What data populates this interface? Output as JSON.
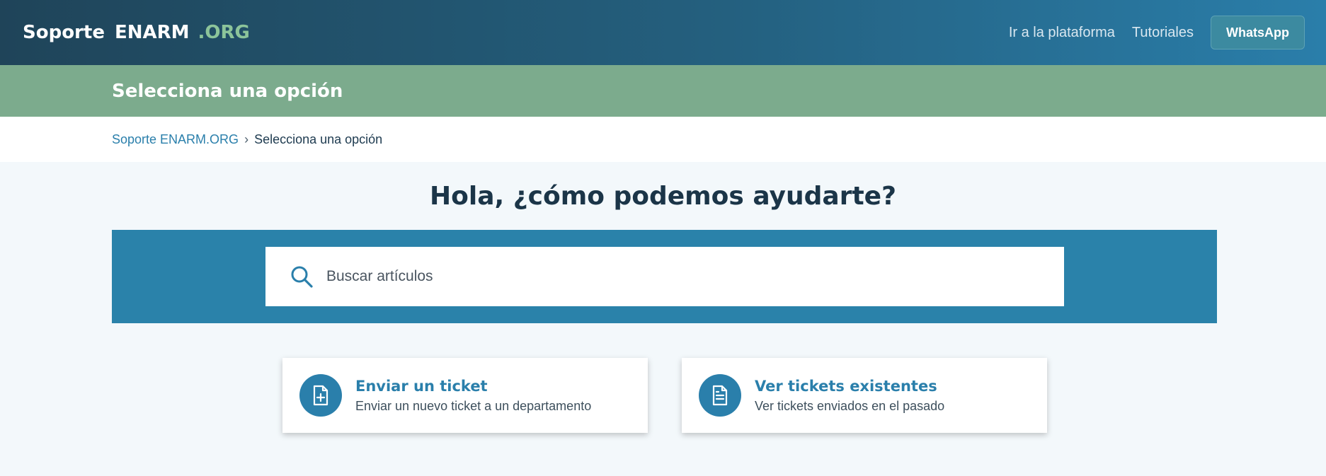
{
  "header": {
    "logo_part1": "Soporte",
    "logo_part2": "ENARM",
    "logo_part3": ".ORG",
    "nav_platform": "Ir a la plataforma",
    "nav_tutorials": "Tutoriales",
    "whatsapp_label": "WhatsApp"
  },
  "banner": {
    "title": "Selecciona una opción"
  },
  "breadcrumb": {
    "home": "Soporte ENARM.ORG",
    "current": "Selecciona una opción"
  },
  "hero": {
    "title": "Hola, ¿cómo podemos ayudarte?"
  },
  "search": {
    "placeholder": "Buscar artículos",
    "icon": "search-icon"
  },
  "cards": [
    {
      "title": "Enviar un ticket",
      "desc": "Enviar un nuevo ticket a un departamento",
      "icon": "file-plus-icon"
    },
    {
      "title": "Ver tickets existentes",
      "desc": "Ver tickets enviados en el pasado",
      "icon": "file-text-icon"
    }
  ],
  "colors": {
    "accent": "#2a7fab",
    "banner": "#7cab8d",
    "logo_org": "#8cc49a"
  }
}
